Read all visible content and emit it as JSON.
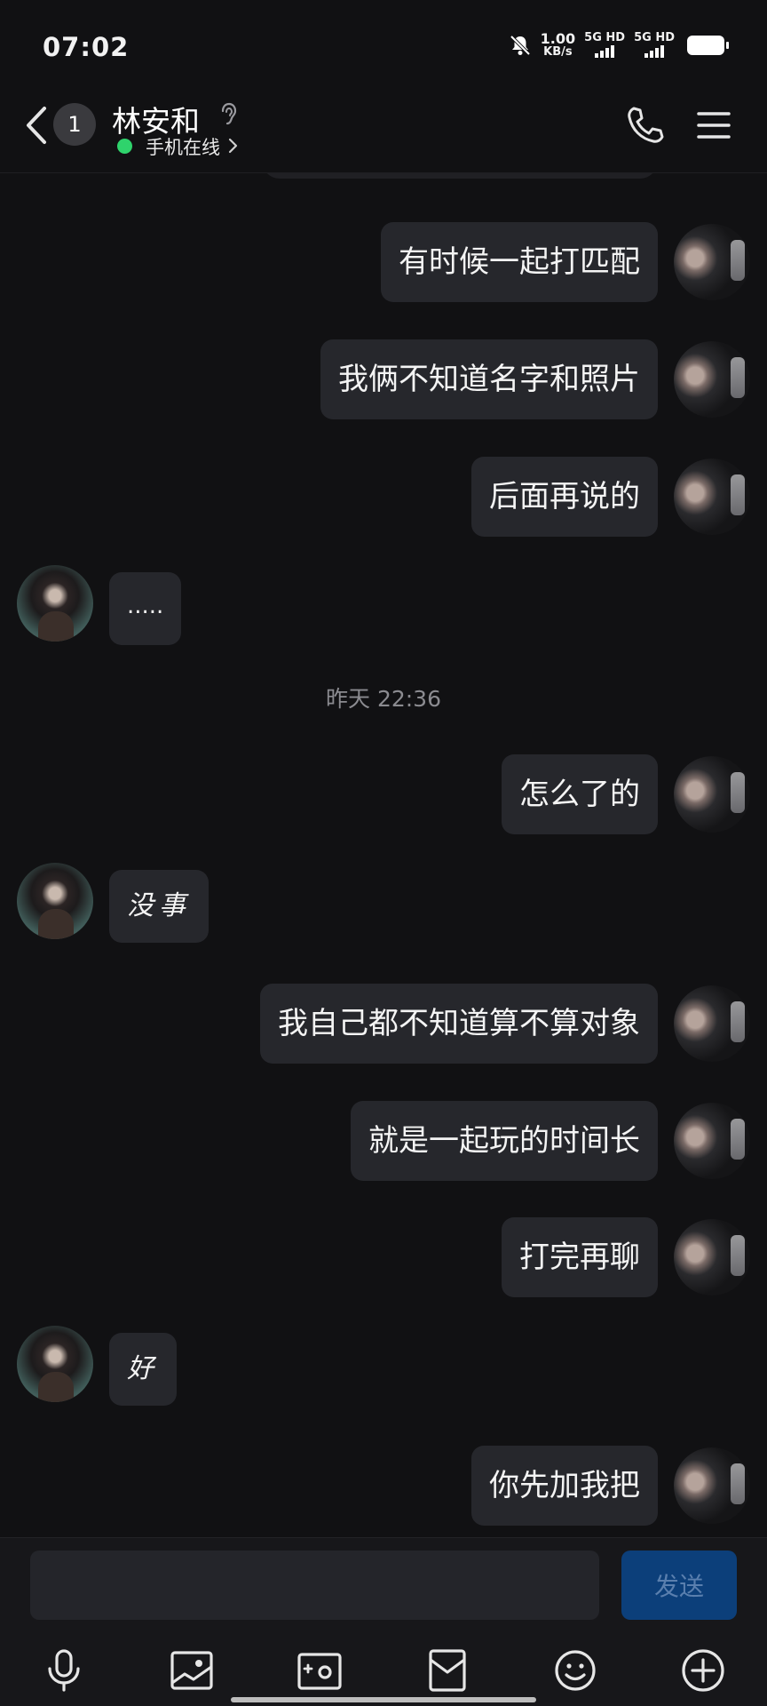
{
  "status_bar": {
    "time": "07:02",
    "net_speed_value": "1.00",
    "net_speed_unit": "KB/s",
    "sim1_label": "5G HD",
    "sim2_label": "5G HD",
    "icons": [
      "mute-bell-icon",
      "signal-icon",
      "signal-icon",
      "battery-icon"
    ]
  },
  "header": {
    "unread_count": "1",
    "contact_name": "林安和",
    "status_text": "手机在线",
    "status_color": "#2fd36c",
    "icons": [
      "back-chevron-icon",
      "ear-icon",
      "phone-icon",
      "menu-icon"
    ]
  },
  "chat": {
    "timestamp": "昨天 22:36",
    "messages": [
      {
        "side": "right",
        "text": "有时候一起打匹配"
      },
      {
        "side": "right",
        "text": "我俩不知道名字和照片"
      },
      {
        "side": "right",
        "text": "后面再说的"
      },
      {
        "side": "left",
        "text": "....."
      },
      {
        "side": "right",
        "text": "怎么了的"
      },
      {
        "side": "left",
        "text": "没事"
      },
      {
        "side": "right",
        "text": "我自己都不知道算不算对象"
      },
      {
        "side": "right",
        "text": "就是一起玩的时间长"
      },
      {
        "side": "right",
        "text": "打完再聊"
      },
      {
        "side": "left",
        "text": "好"
      },
      {
        "side": "right",
        "text": "你先加我把"
      }
    ]
  },
  "input": {
    "value": "",
    "send_label": "发送"
  },
  "toolbar": {
    "icons": [
      "microphone-icon",
      "image-icon",
      "camera-icon",
      "red-packet-icon",
      "emoji-icon",
      "plus-circle-icon"
    ]
  },
  "colors": {
    "background": "#111113",
    "bubble": "#26272c",
    "send_button": "#0c3f7a"
  }
}
